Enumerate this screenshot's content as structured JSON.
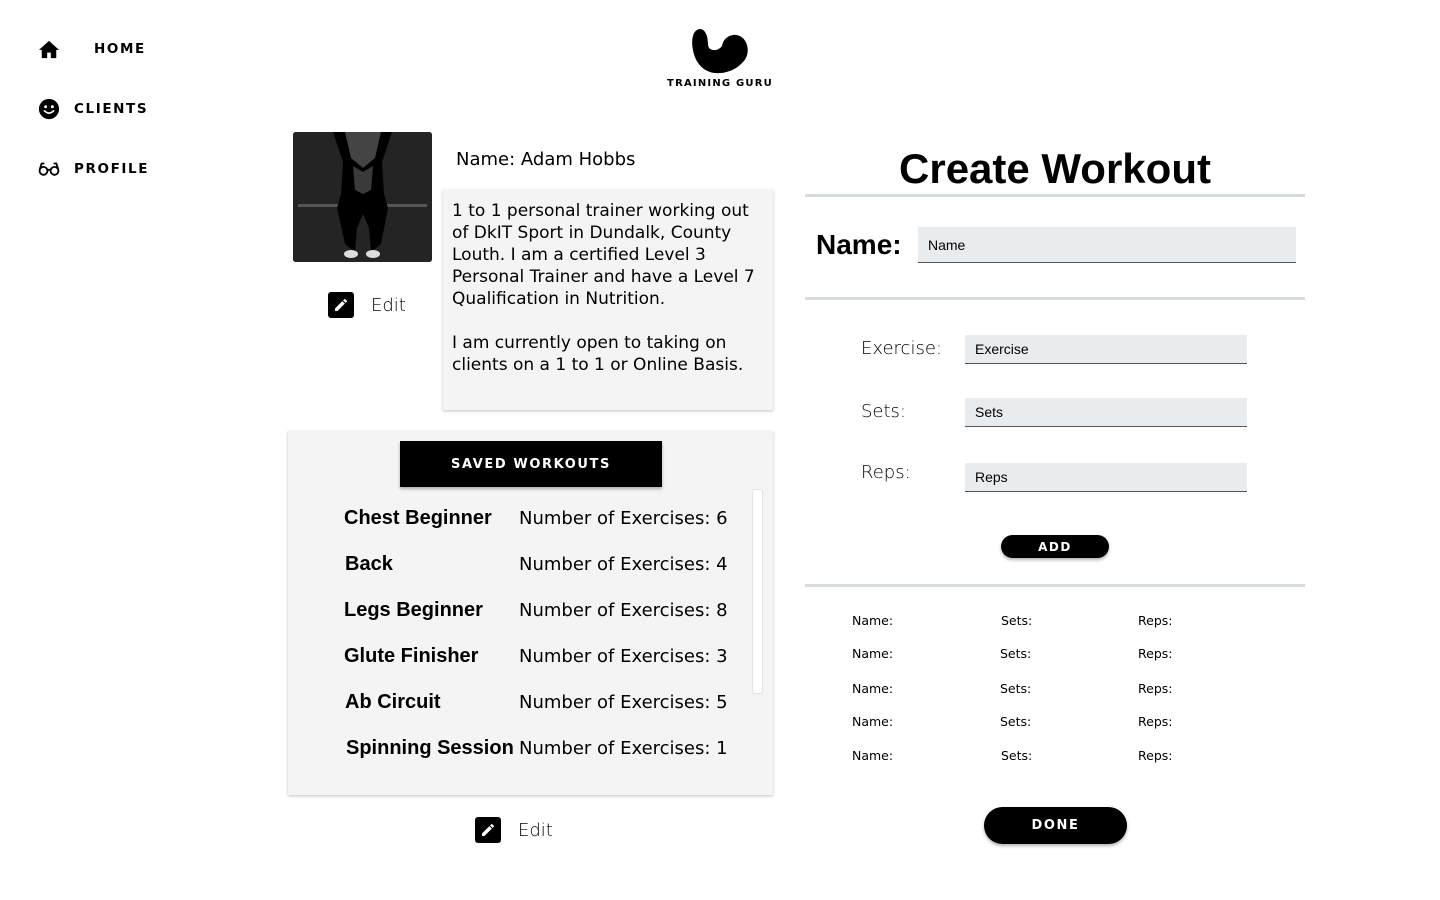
{
  "nav": {
    "items": [
      {
        "label": "HOME",
        "icon": "home-icon"
      },
      {
        "label": "CLIENTS",
        "icon": "smiley-icon"
      },
      {
        "label": "PROFILE",
        "icon": "glasses-icon"
      }
    ]
  },
  "logo": {
    "text": "TRAINING GURU",
    "icon": "flexing-arm-logo"
  },
  "profile": {
    "photo": "athlete-back-photo",
    "name_line": "Name: Adam Hobbs",
    "bio": [
      "1 to 1 personal trainer working out of DkIT Sport in Dundalk, County Louth. I am a certified Level 3 Personal Trainer and have a Level 7 Qualification in Nutrition.",
      "I am currently open to taking on clients on a 1 to 1 or Online Basis."
    ],
    "edit_label": "Edit"
  },
  "saved_workouts": {
    "button_label": "SAVED WORKOUTS",
    "items": [
      {
        "name": "Chest Beginner",
        "count_text": "Number of Exercises: 6"
      },
      {
        "name": "Back",
        "count_text": "Number of Exercises: 4"
      },
      {
        "name": "Legs Beginner",
        "count_text": "Number of Exercises: 8"
      },
      {
        "name": "Glute Finisher",
        "count_text": "Number of Exercises: 3"
      },
      {
        "name": "Ab Circuit",
        "count_text": "Number of Exercises: 5"
      },
      {
        "name": "Spinning Session",
        "count_text": "Number of Exercises: 1"
      }
    ],
    "edit_label": "Edit"
  },
  "create_workout": {
    "title": "Create Workout",
    "name_label": "Name:",
    "name_placeholder": "Name",
    "exercise_label": "Exercise:",
    "exercise_placeholder": "Exercise",
    "sets_label": "Sets:",
    "sets_placeholder": "Sets",
    "reps_label": "Reps:",
    "reps_placeholder": "Reps",
    "add_label": "ADD",
    "rows": [
      {
        "name": "Name:",
        "sets": "Sets:",
        "reps": "Reps:"
      },
      {
        "name": "Name:",
        "sets": "Sets:",
        "reps": "Reps:"
      },
      {
        "name": "Name:",
        "sets": "Sets:",
        "reps": "Reps:"
      },
      {
        "name": "Name:",
        "sets": "Sets:",
        "reps": "Reps:"
      },
      {
        "name": "Name:",
        "sets": "Sets:",
        "reps": "Reps:"
      }
    ],
    "done_label": "DONE"
  }
}
